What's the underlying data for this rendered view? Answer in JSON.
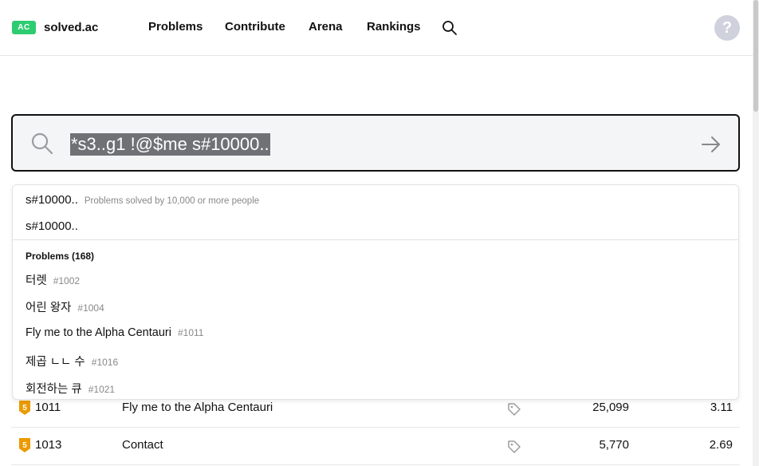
{
  "header": {
    "logo_badge": "AC",
    "logo_text": "solved.ac",
    "nav": [
      "Problems",
      "Contribute",
      "Arena",
      "Rankings"
    ],
    "help_label": "?"
  },
  "search": {
    "value": "*s3..g1 !@$me s#10000.."
  },
  "dropdown": {
    "suggestions": [
      {
        "text": "s#10000..",
        "desc": "Problems solved by 10,000 or more people"
      },
      {
        "text": "s#10000..",
        "desc": ""
      }
    ],
    "section_title": "Problems (168)",
    "problems": [
      {
        "title": "터렛",
        "id": "#1002"
      },
      {
        "title": "어린 왕자",
        "id": "#1004"
      },
      {
        "title": "Fly me to the Alpha Centauri",
        "id": "#1011"
      },
      {
        "title": "제곱 ㄴㄴ 수",
        "id": "#1016"
      },
      {
        "title": "회전하는 큐",
        "id": "#1021"
      }
    ]
  },
  "table": {
    "rows": [
      {
        "tier": "5",
        "id": "1011",
        "title": "Fly me to the Alpha Centauri",
        "solved": "25,099",
        "tries": "3.11"
      },
      {
        "tier": "5",
        "id": "1013",
        "title": "Contact",
        "solved": "5,770",
        "tries": "2.69"
      }
    ]
  },
  "colors": {
    "brand_green": "#2ecc71",
    "tier_gold": "#ec9a00",
    "help_gray": "#cfd2dc",
    "selection_gray": "#6f7175"
  }
}
